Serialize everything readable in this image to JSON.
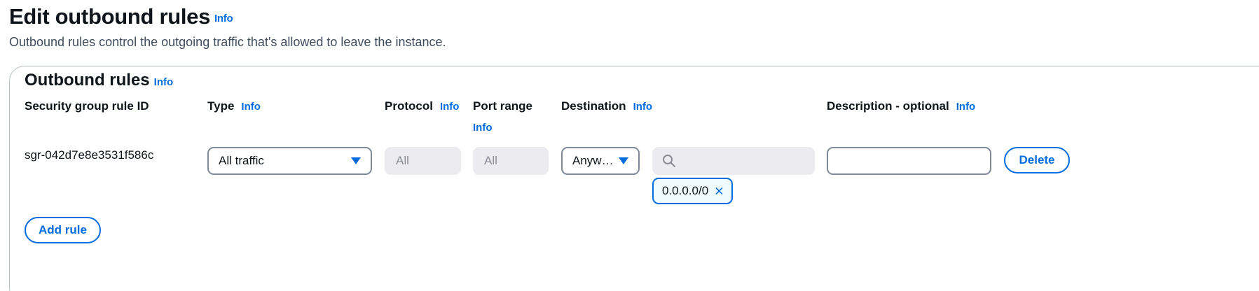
{
  "header": {
    "title": "Edit outbound rules",
    "info": "Info",
    "description": "Outbound rules control the outgoing traffic that's allowed to leave the instance."
  },
  "panel": {
    "title": "Outbound rules",
    "info": "Info",
    "columns": {
      "rule_id": "Security group rule ID",
      "type": "Type",
      "type_info": "Info",
      "protocol": "Protocol",
      "protocol_info": "Info",
      "port_range": "Port range",
      "port_range_info": "Info",
      "destination": "Destination",
      "destination_info": "Info",
      "description": "Description - optional",
      "description_info": "Info"
    },
    "rule": {
      "id": "sgr-042d7e8e3531f586c",
      "type": "All traffic",
      "protocol": "All",
      "port_range": "All",
      "destination": "Anyw…",
      "destination_search_placeholder": "",
      "destination_token": "0.0.0.0/0",
      "description_value": "",
      "delete_label": "Delete"
    },
    "add_rule_label": "Add rule"
  },
  "colors": {
    "accent": "#006ce0",
    "border": "#7d8998",
    "disabled_bg": "#ebebf0"
  },
  "icons": [
    "info-link",
    "caret-down-icon",
    "search-icon",
    "close-icon"
  ]
}
